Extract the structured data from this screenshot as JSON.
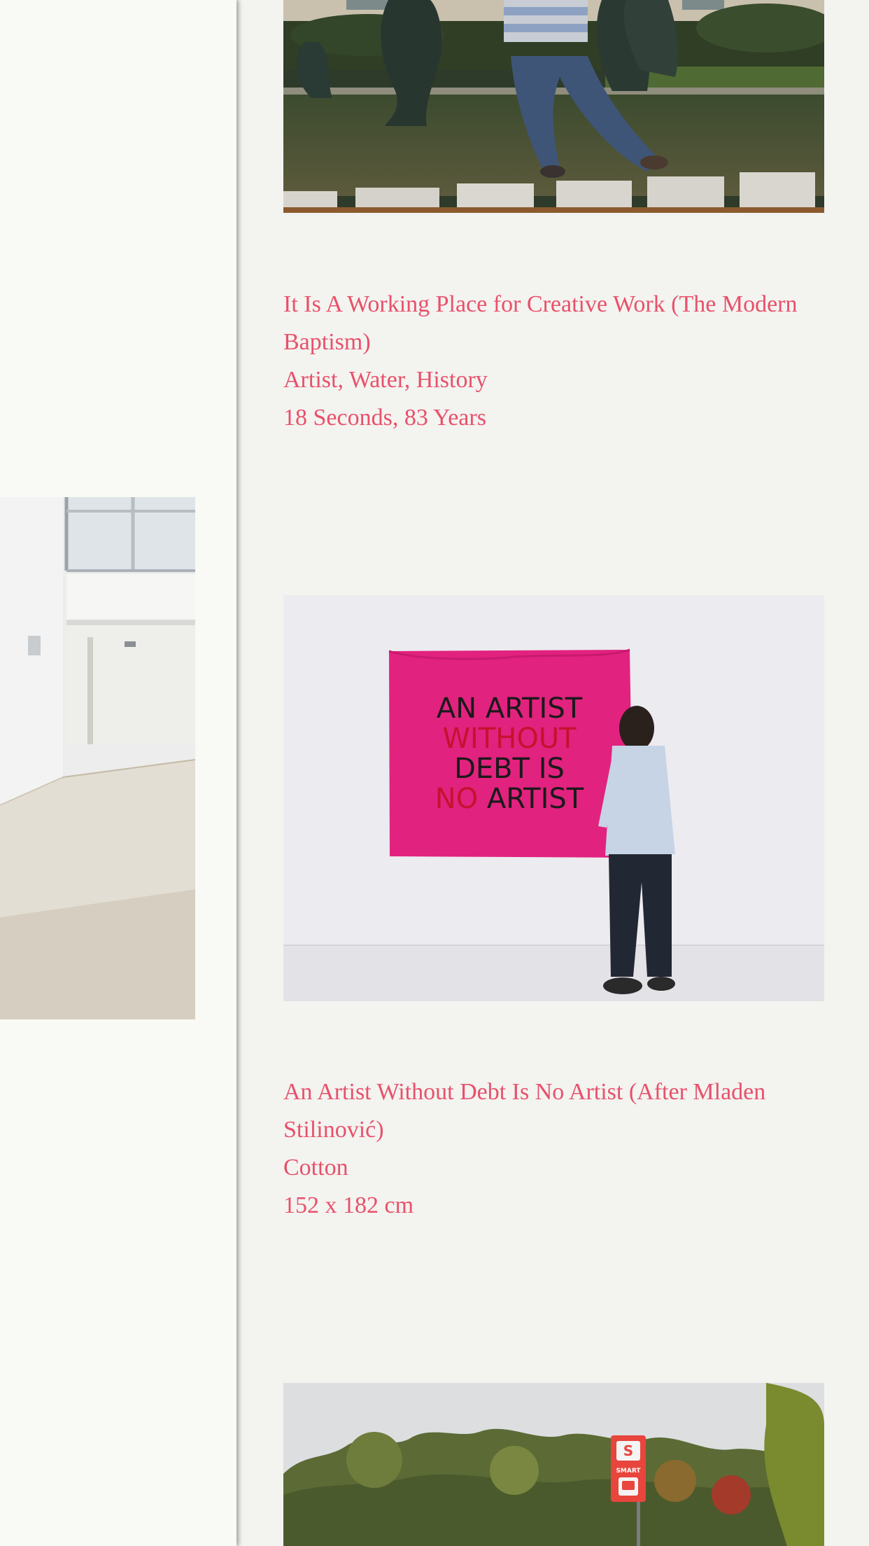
{
  "artworks": [
    {
      "title": "It Is A Working Place for Creative Work (The Modern Baptism)",
      "medium": "Artist, Water, History",
      "dimensions": "18 Seconds, 83 Years"
    },
    {
      "title": "An Artist Without Debt Is No Artist (After Mladen Stilinović)",
      "medium": "Cotton",
      "dimensions": "152 x 182 cm",
      "banner_text": {
        "line1": "AN ARTIST",
        "line2": "WITHOUT",
        "line3": "DEBT IS",
        "line4_highlight": "NO",
        "line4_rest": " ARTIST"
      }
    }
  ],
  "bus_sign": {
    "brand": "SMART"
  },
  "colors": {
    "accent": "#e8516a",
    "page_background": "#f3f3f0",
    "panel_background": "#f9f9f6",
    "banner_pink": "#e2227f"
  }
}
